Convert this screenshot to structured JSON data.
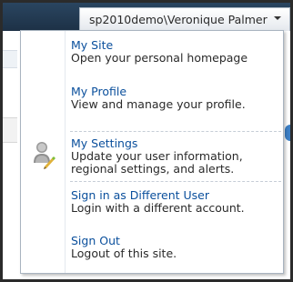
{
  "header": {
    "user_label": "sp2010demo\\Veronique Palmer"
  },
  "menu": {
    "items": [
      {
        "title": "My Site",
        "description": "Open your personal homepage"
      },
      {
        "title": "My Profile",
        "description": "View and manage your profile."
      },
      {
        "title": "My Settings",
        "description": "Update your user information, regional settings, and alerts.",
        "icon": "user-settings-icon"
      },
      {
        "title": "Sign in as Different User",
        "description": "Login with a different account."
      },
      {
        "title": "Sign Out",
        "description": "Logout of this site."
      }
    ],
    "settings_description_lines": [
      "Update your user information,",
      "regional settings, and alerts."
    ]
  },
  "colors": {
    "ribbon": "#21374c",
    "link": "#0a4f9c",
    "border": "#a9b4c0"
  }
}
